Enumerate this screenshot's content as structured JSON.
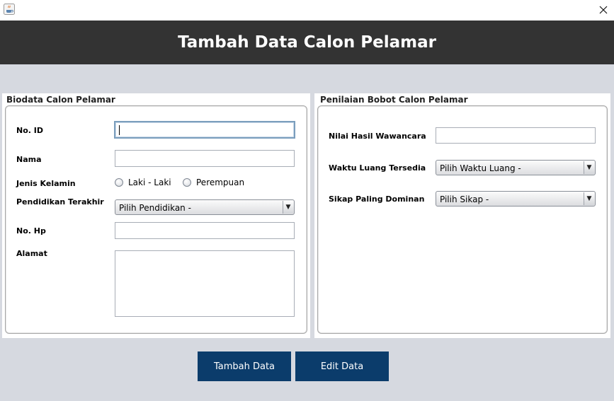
{
  "window": {
    "app_icon": "java-cup-icon",
    "close_icon": "close-icon"
  },
  "header": {
    "title": "Tambah Data Calon Pelamar"
  },
  "biodata": {
    "title": "Biodata Calon Pelamar",
    "id_label": "No. ID",
    "id_value": "",
    "nama_label": "Nama",
    "nama_value": "",
    "gender_label": "Jenis Kelamin",
    "gender_options": [
      "Laki - Laki",
      "Perempuan"
    ],
    "pendidikan_label": "Pendidikan Terakhir",
    "pendidikan_selected": "Pilih Pendidikan -",
    "hp_label": "No. Hp",
    "hp_value": "",
    "alamat_label": "Alamat",
    "alamat_value": ""
  },
  "penilaian": {
    "title": "Penilaian Bobot Calon Pelamar",
    "wawancara_label": "Nilai Hasil Wawancara",
    "wawancara_value": "",
    "waktu_label": "Waktu Luang Tersedia",
    "waktu_selected": "Pilih Waktu Luang -",
    "sikap_label": "Sikap Paling Dominan",
    "sikap_selected": "Pilih Sikap -"
  },
  "actions": {
    "tambah_label": "Tambah Data",
    "edit_label": "Edit Data",
    "button_color": "#0b3c6b"
  },
  "colors": {
    "header_bg": "#333333",
    "page_bg": "#d6d9e0"
  }
}
